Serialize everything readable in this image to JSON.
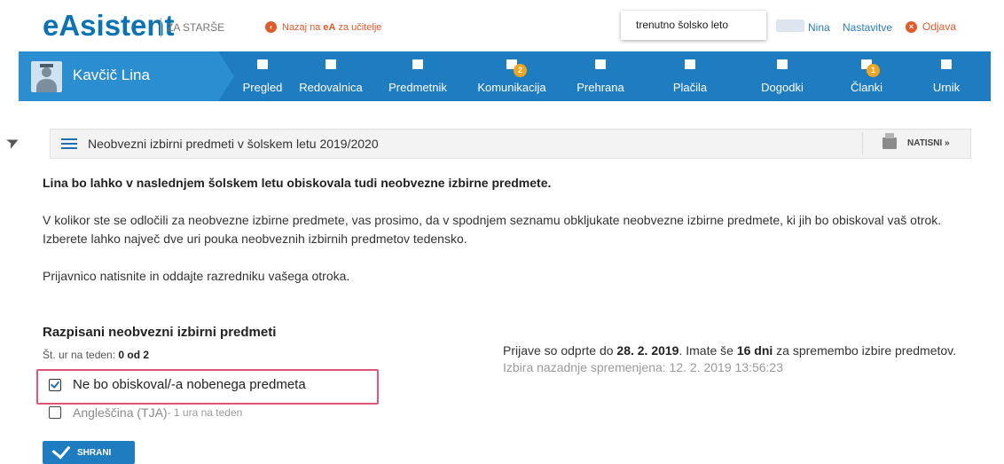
{
  "header": {
    "logo": "eAsistent",
    "logo_sub": "ZA STARŠE",
    "back_prefix": "Nazaj na ",
    "back_bold": "eA",
    "back_suffix": " za učitelje",
    "school_year": "trenutno šolsko leto",
    "user": "Nina",
    "settings": "Nastavitve",
    "logout": "Odjava"
  },
  "nav": {
    "student": "Kavčič Lina",
    "items": [
      {
        "label": "Pregled"
      },
      {
        "label": "Redovalnica"
      },
      {
        "label": "Predmetnik"
      },
      {
        "label": "Komunikacija",
        "badge": "2"
      },
      {
        "label": "Prehrana"
      },
      {
        "label": "Plačila"
      },
      {
        "label": "Dogodki"
      },
      {
        "label": "Članki",
        "badge": "1"
      },
      {
        "label": "Urnik"
      }
    ]
  },
  "main": {
    "title": "Neobvezni izbirni predmeti v šolskem letu 2019/2020",
    "print": "NATISNI »",
    "heading": "Lina bo lahko v naslednjem šolskem letu obiskovala tudi neobvezne izbirne predmete.",
    "para1": "V kolikor ste se odločili za neobvezne izbirne predmete, vas prosimo, da v spodnjem seznamu obkljukate neobvezne izbirne predmete, ki jih bo obiskoval vaš otrok. Izberete lahko največ dve uri pouka neobveznih izbirnih predmetov tedensko.",
    "para2": "Prijavnico natisnite in oddajte razredniku vašega otroka.",
    "section_title": "Razpisani neobvezni izbirni predmeti",
    "hours_label": "Št. ur na teden: ",
    "hours_value": "0 od 2",
    "option1": "Ne bo obiskoval/-a nobenega predmeta",
    "option2": "Angleščina (TJA)",
    "option2_hours": " - 1 ura na teden",
    "save": "SHRANI",
    "deadline_prefix": "Prijave so odprte do ",
    "deadline_date": "28. 2. 2019",
    "deadline_mid": ". Imate še ",
    "deadline_days": "16 dni",
    "deadline_suffix": " za spremembo izbire predmetov.",
    "last_changed": "Izbira nazadnje spremenjena: 12. 2. 2019 13:56:23"
  }
}
